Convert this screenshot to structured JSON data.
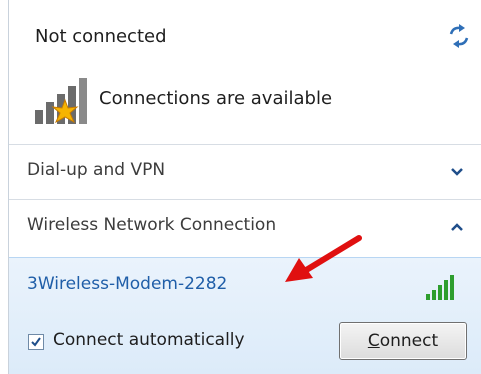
{
  "status": {
    "title": "Not connected",
    "availability": "Connections are available",
    "refresh_icon": "network-refresh-icon"
  },
  "sections": [
    {
      "label": "Dial-up and VPN",
      "state": "collapsed"
    },
    {
      "label": "Wireless Network Connection",
      "state": "expanded"
    }
  ],
  "network": {
    "name": "3Wireless-Modem-2282",
    "connect_automatically_label": "Connect automatically",
    "connect_automatically_checked": true,
    "connect_button_mnemonic": "C",
    "connect_button_rest": "onnect"
  },
  "colors": {
    "link_blue": "#1f5ea8",
    "signal_green": "#2e9e2e",
    "arrow_red": "#e01010",
    "selected_bg": "#dcebf9"
  }
}
